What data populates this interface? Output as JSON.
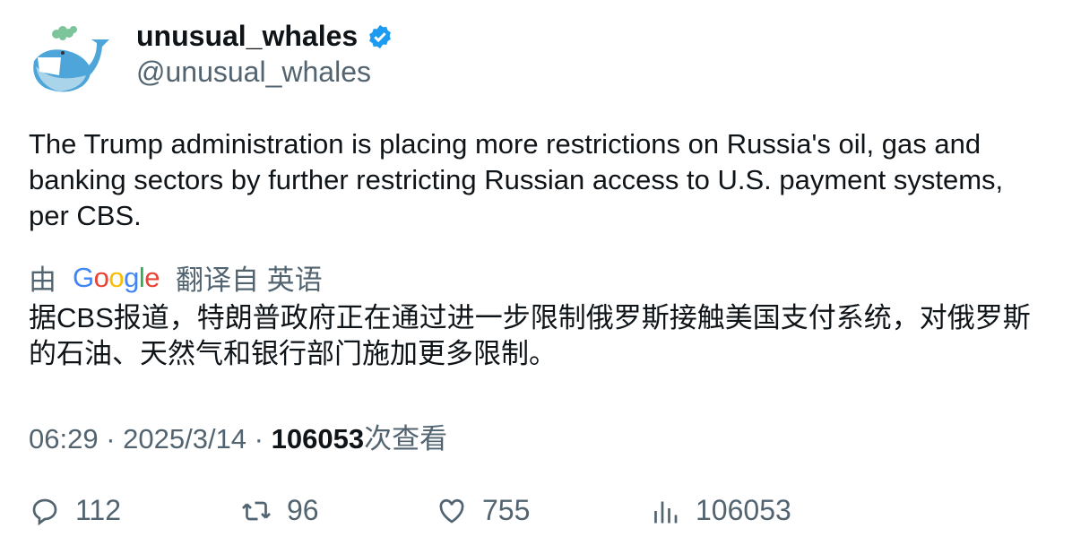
{
  "author": {
    "name": "unusual_whales",
    "handle": "@unusual_whales",
    "verified": true
  },
  "tweet": {
    "text": "The Trump administration is placing more restrictions on Russia's oil, gas and banking sectors by further restricting Russian access to U.S. payment systems, per CBS."
  },
  "translation": {
    "prefix": "由",
    "logo": "Google",
    "suffix": "翻译自 英语",
    "text": "据CBS报道，特朗普政府正在通过进一步限制俄罗斯接触美国支付系统，对俄罗斯的石油、天然气和银行部门施加更多限制。"
  },
  "meta": {
    "time": "06:29",
    "sep": " · ",
    "date": "2025/3/14",
    "views": "106053",
    "views_label": "次查看"
  },
  "stats": {
    "replies": "112",
    "retweets": "96",
    "likes": "755",
    "views": "106053"
  },
  "colors": {
    "text": "#0f1419",
    "muted": "#536471",
    "verified": "#1d9bf0",
    "google": [
      "#4285f4",
      "#ea4335",
      "#fbbc05",
      "#4285f4",
      "#34a853",
      "#ea4335"
    ]
  }
}
